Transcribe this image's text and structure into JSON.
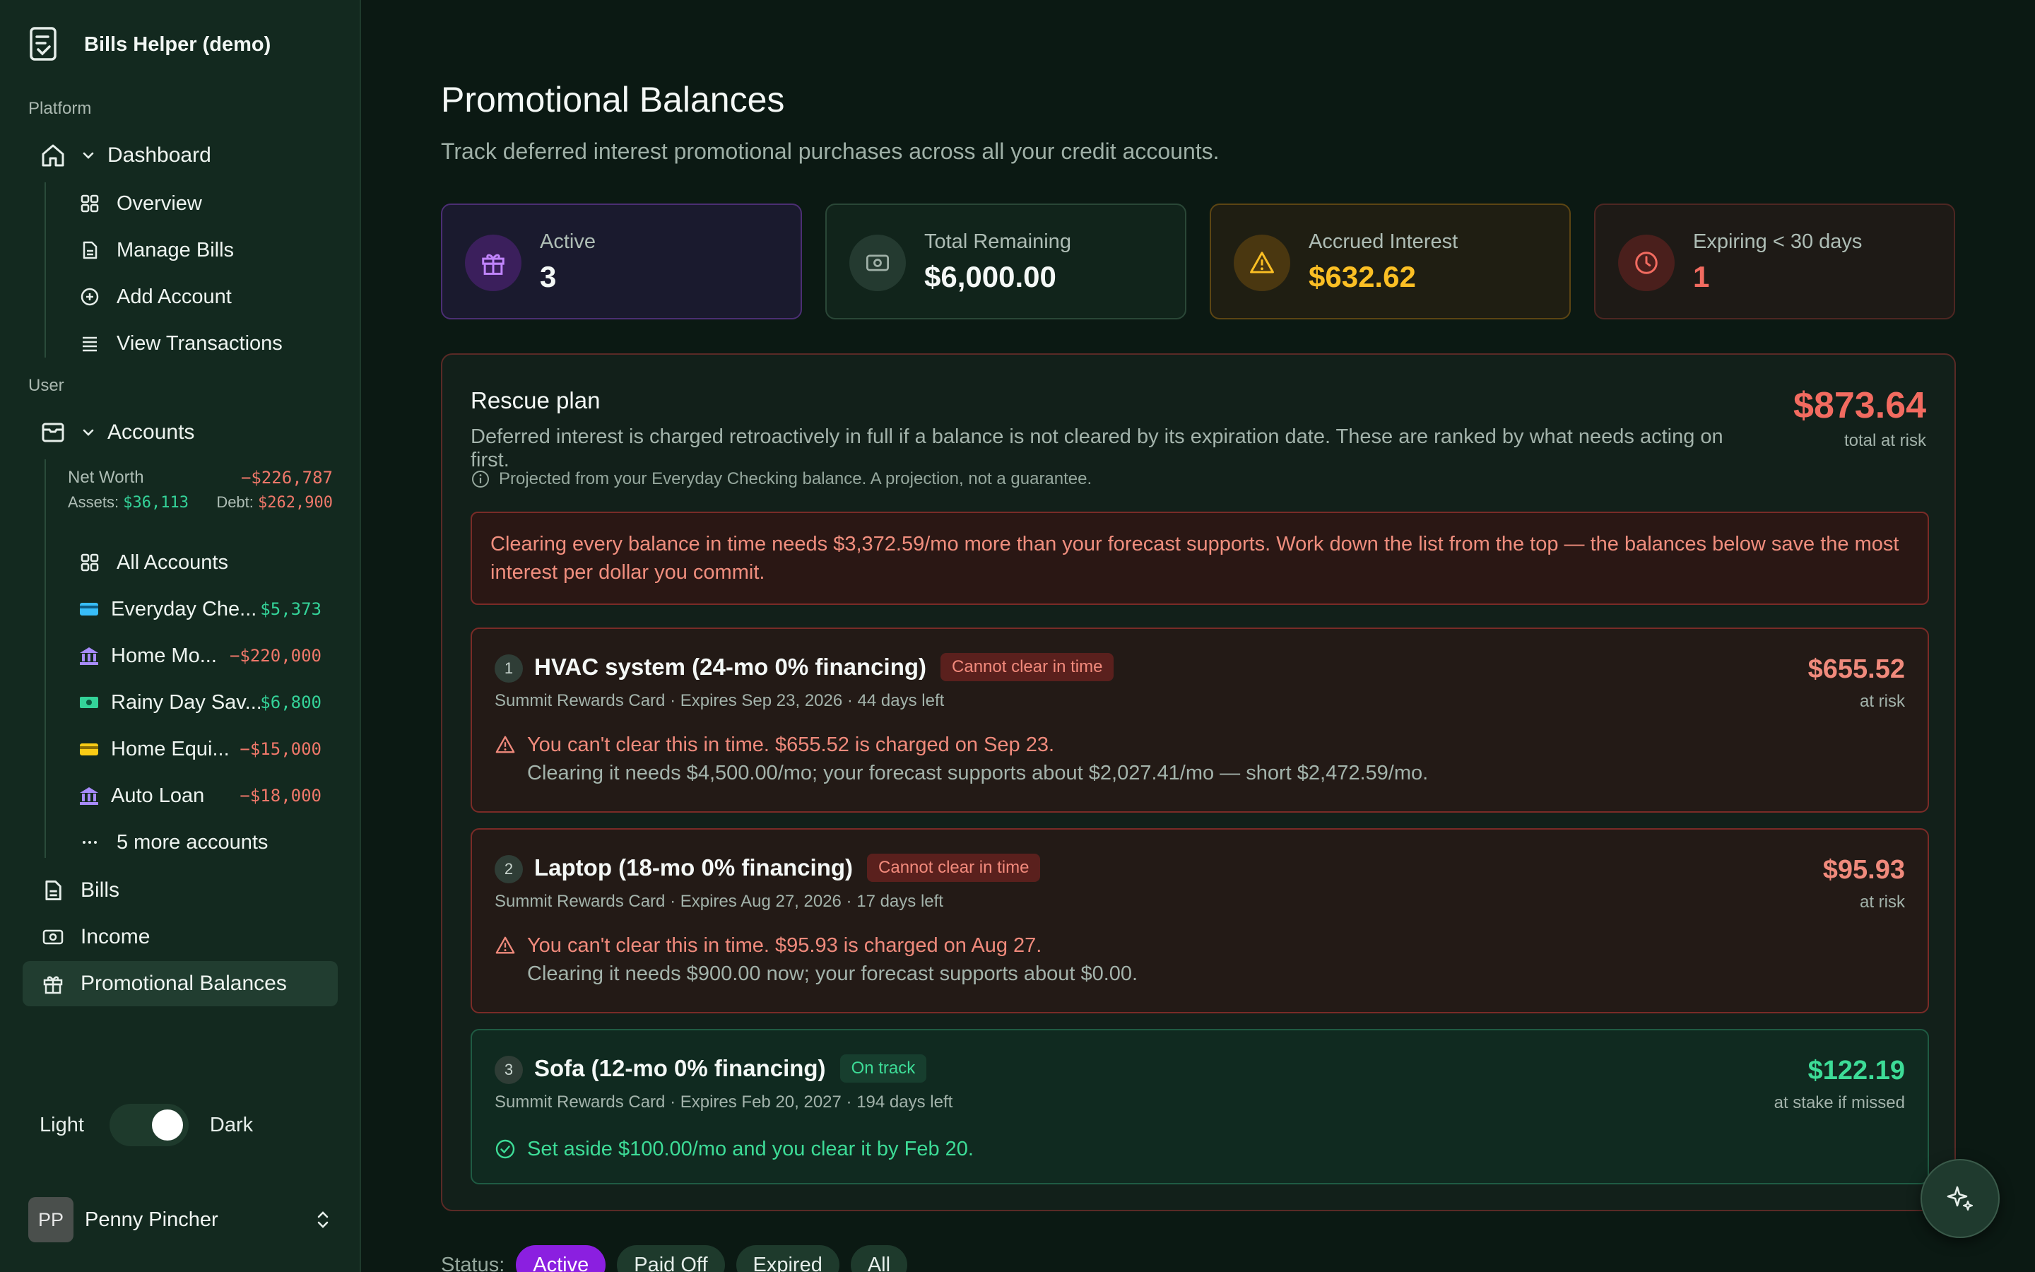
{
  "app": {
    "name": "Bills Helper (demo)"
  },
  "sidebar": {
    "platform_label": "Platform",
    "dashboard_label": "Dashboard",
    "dashboard_items": [
      {
        "label": "Overview"
      },
      {
        "label": "Manage Bills"
      },
      {
        "label": "Add Account"
      },
      {
        "label": "View Transactions"
      }
    ],
    "user_label": "User",
    "accounts_label": "Accounts",
    "net_worth": {
      "label": "Net Worth",
      "value": "−$226,787",
      "assets_label": "Assets:",
      "assets_value": "$36,113",
      "debt_label": "Debt:",
      "debt_value": "$262,900"
    },
    "all_accounts_label": "All Accounts",
    "accounts": [
      {
        "name": "Everyday Che...",
        "amount": "$5,373",
        "icon": "card-icon",
        "color": "#38bdf8"
      },
      {
        "name": "Home Mo...",
        "amount": "−$220,000",
        "icon": "bank-icon",
        "color": "#a78bfa"
      },
      {
        "name": "Rainy Day Sav...",
        "amount": "$6,800",
        "icon": "cash-icon",
        "color": "#34d399"
      },
      {
        "name": "Home Equi...",
        "amount": "−$15,000",
        "icon": "credit-card-icon",
        "color": "#facc15"
      },
      {
        "name": "Auto Loan",
        "amount": "−$18,000",
        "icon": "bank-icon",
        "color": "#a78bfa"
      }
    ],
    "more_accounts": "5 more accounts",
    "bills_label": "Bills",
    "income_label": "Income",
    "promo_label": "Promotional Balances",
    "theme": {
      "light": "Light",
      "dark": "Dark",
      "mode": "dark"
    },
    "user": {
      "initials": "PP",
      "name": "Penny Pincher"
    }
  },
  "page": {
    "title": "Promotional Balances",
    "subtitle": "Track deferred interest promotional purchases across all your credit accounts."
  },
  "stats": [
    {
      "label": "Active",
      "value": "3",
      "icon": "gift-icon",
      "accent": "#a855f7"
    },
    {
      "label": "Total Remaining",
      "value": "$6,000.00",
      "icon": "money-icon",
      "accent": "#9fb0a7"
    },
    {
      "label": "Accrued Interest",
      "value": "$632.62",
      "icon": "warning-icon",
      "accent": "#fbbf24"
    },
    {
      "label": "Expiring < 30 days",
      "value": "1",
      "icon": "clock-icon",
      "accent": "#f26b60"
    }
  ],
  "rescue": {
    "title": "Rescue plan",
    "description": "Deferred interest is charged retroactively in full if a balance is not cleared by its expiration date. These are ranked by what needs acting on first.",
    "total": "$873.64",
    "total_label": "total at risk",
    "note": "Projected from your Everyday Checking balance. A projection, not a guarantee.",
    "warning": "Clearing every balance in time needs $3,372.59/mo more than your forecast supports. Work down the list from the top — the balances below save the most interest per dollar you commit.",
    "items": [
      {
        "rank": "1",
        "name": "HVAC system (24-mo 0% financing)",
        "badge": "Cannot clear in time",
        "meta": "Summit Rewards Card · Expires Sep 23, 2026 · 44 days left",
        "amount": "$655.52",
        "amount_label": "at risk",
        "line1": "You can't clear this in time. $655.52 is charged on Sep 23.",
        "line2": "Clearing it needs $4,500.00/mo; your forecast supports about $2,027.41/mo — short $2,472.59/mo."
      },
      {
        "rank": "2",
        "name": "Laptop (18-mo 0% financing)",
        "badge": "Cannot clear in time",
        "meta": "Summit Rewards Card · Expires Aug 27, 2026 · 17 days left",
        "amount": "$95.93",
        "amount_label": "at risk",
        "line1": "You can't clear this in time. $95.93 is charged on Aug 27.",
        "line2": "Clearing it needs $900.00 now; your forecast supports about $0.00."
      },
      {
        "rank": "3",
        "name": "Sofa (12-mo 0% financing)",
        "badge": "On track",
        "meta": "Summit Rewards Card · Expires Feb 20, 2027 · 194 days left",
        "amount": "$122.19",
        "amount_label": "at stake if missed",
        "line1": "Set aside $100.00/mo and you clear it by Feb 20."
      }
    ]
  },
  "filters": {
    "label": "Status:",
    "options": [
      {
        "label": "Active"
      },
      {
        "label": "Paid Off"
      },
      {
        "label": "Expired"
      },
      {
        "label": "All"
      }
    ]
  }
}
